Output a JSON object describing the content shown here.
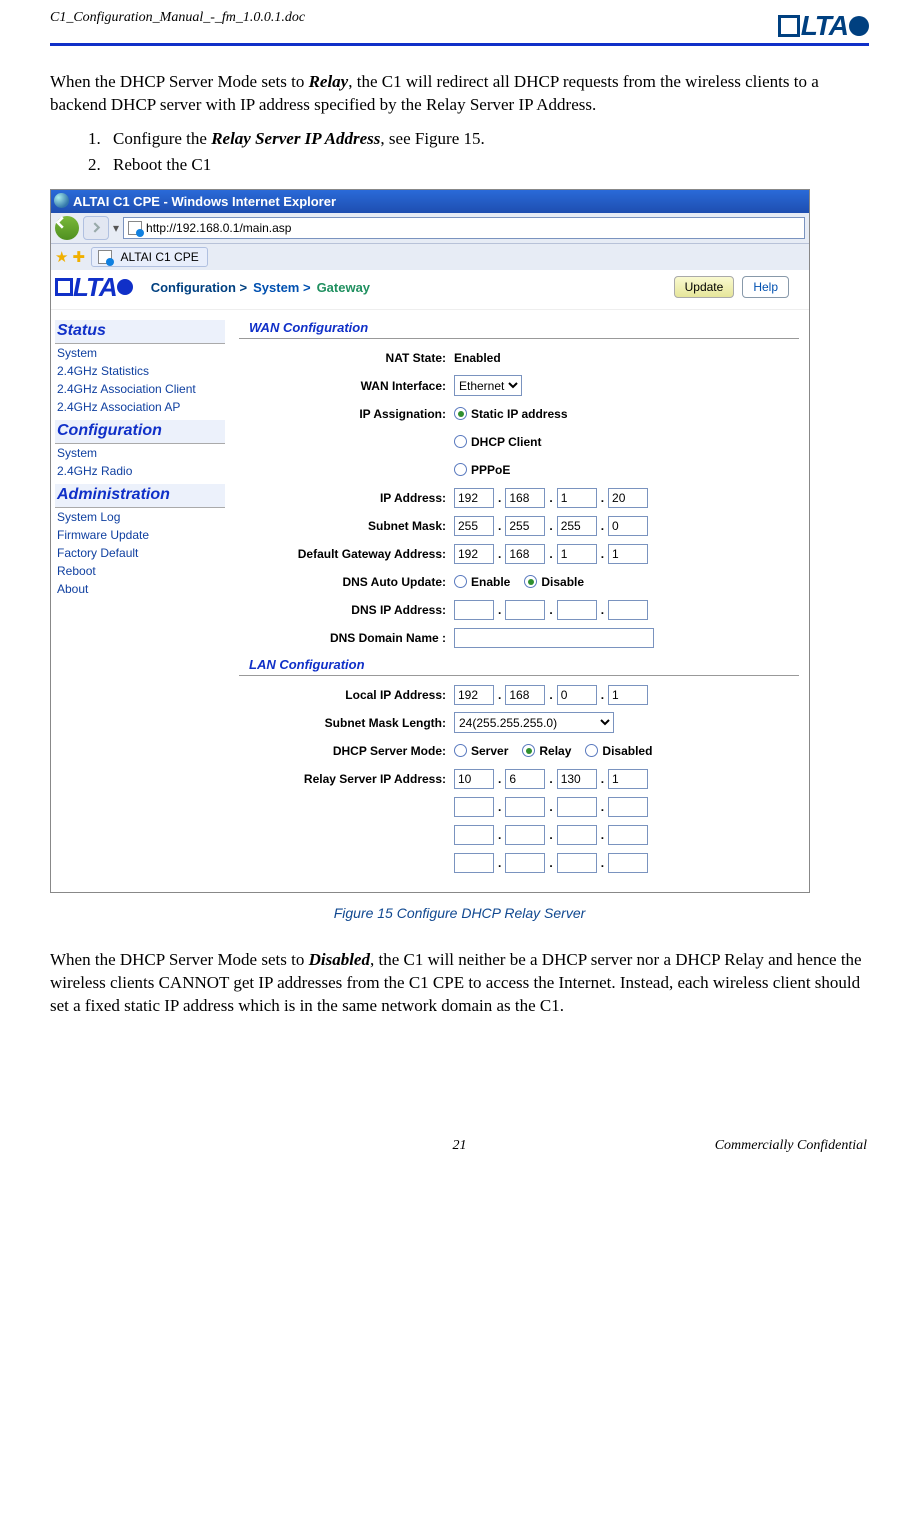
{
  "header_doc": "C1_Configuration_Manual_-_fm_1.0.0.1.doc",
  "logo_text": "LTA",
  "p1_a": "When the DHCP Server Mode sets to ",
  "p1_b": "Relay",
  "p1_c": ", the C1 will redirect all DHCP requests from the wireless clients to a backend DHCP server with IP address specified by the Relay Server IP Address.",
  "li1_a": "Configure the ",
  "li1_b": "Relay Server IP Address",
  "li1_c": ", see Figure 15.",
  "li2": "Reboot the C1",
  "ie": {
    "title": "ALTAI C1 CPE - Windows Internet Explorer",
    "url": "http://192.168.0.1/main.asp",
    "tab": "ALTAI C1 CPE"
  },
  "bc": {
    "c": "Configuration >",
    "s": "System >",
    "g": "Gateway"
  },
  "btn_update": "Update",
  "btn_help": "Help",
  "side": {
    "status": "Status",
    "s_system": "System",
    "s_24stats": "2.4GHz Statistics",
    "s_24ac": "2.4GHz Association Client",
    "s_24ap": "2.4GHz Association AP",
    "config": "Configuration",
    "c_system": "System",
    "c_radio": "2.4GHz Radio",
    "admin": "Administration",
    "a_log": "System Log",
    "a_fw": "Firmware Update",
    "a_def": "Factory Default",
    "a_reboot": "Reboot",
    "a_about": "About"
  },
  "wan": {
    "title": "WAN Configuration",
    "nat_lbl": "NAT State:",
    "nat_val": "Enabled",
    "wanif_lbl": "WAN Interface:",
    "wanif_val": "Ethernet",
    "ipa_lbl": "IP Assignation:",
    "r_static": "Static IP address",
    "r_dhcp": "DHCP Client",
    "r_pppoe": "PPPoE",
    "ip_lbl": "IP Address:",
    "ip": [
      "192",
      "168",
      "1",
      "20"
    ],
    "mask_lbl": "Subnet Mask:",
    "mask": [
      "255",
      "255",
      "255",
      "0"
    ],
    "gw_lbl": "Default Gateway Address:",
    "gw": [
      "192",
      "168",
      "1",
      "1"
    ],
    "dnsauto_lbl": "DNS Auto Update:",
    "r_enable": "Enable",
    "r_disable": "Disable",
    "dnsip_lbl": "DNS IP Address:",
    "dnsip": [
      "",
      "",
      "",
      ""
    ],
    "dnsdom_lbl": "DNS Domain Name :",
    "dnsdom_val": ""
  },
  "lan": {
    "title": "LAN Configuration",
    "lip_lbl": "Local IP Address:",
    "lip": [
      "192",
      "168",
      "0",
      "1"
    ],
    "smlen_lbl": "Subnet Mask Length:",
    "smlen_val": "24(255.255.255.0)",
    "dhcp_lbl": "DHCP Server Mode:",
    "r_server": "Server",
    "r_relay": "Relay",
    "r_disabled": "Disabled",
    "relayip_lbl": "Relay Server IP Address:",
    "relayip1": [
      "10",
      "6",
      "130",
      "1"
    ],
    "relayip2": [
      "",
      "",
      "",
      ""
    ],
    "relayip3": [
      "",
      "",
      "",
      ""
    ],
    "relayip4": [
      "",
      "",
      "",
      ""
    ]
  },
  "caption": "Figure 15    Configure DHCP Relay Server",
  "p2_a": "When the DHCP Server Mode sets to ",
  "p2_b": "Disabled",
  "p2_c": ", the C1 will neither be a DHCP server nor a DHCP Relay and hence the wireless clients CANNOT get IP addresses from the C1 CPE to access the Internet. Instead, each wireless client should set a fixed static IP address which is in the same network domain as the C1.",
  "page_num": "21",
  "footer_conf": "Commercially Confidential"
}
